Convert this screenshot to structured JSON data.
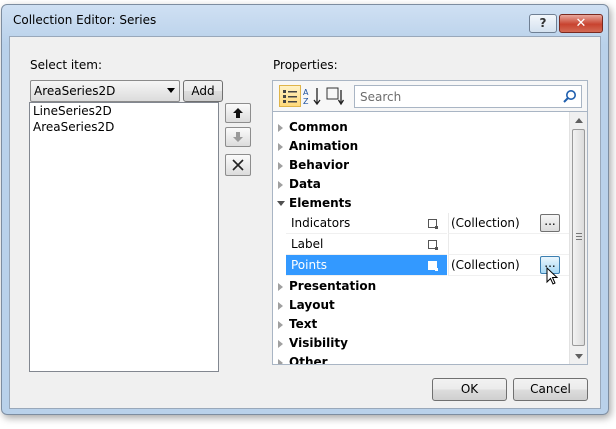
{
  "window": {
    "title": "Collection Editor: Series",
    "help_label": "?",
    "close_label": "✕"
  },
  "left": {
    "select_label": "Select item:",
    "combo_value": "AreaSeries2D",
    "add_label": "Add",
    "items": [
      "LineSeries2D",
      "AreaSeries2D"
    ]
  },
  "right": {
    "properties_label": "Properties:",
    "search_placeholder": "Search",
    "categories": {
      "common": "Common",
      "animation": "Animation",
      "behavior": "Behavior",
      "data": "Data",
      "elements": "Elements",
      "presentation": "Presentation",
      "layout": "Layout",
      "text": "Text",
      "visibility": "Visibility",
      "other": "Other"
    },
    "props": [
      {
        "name": "Indicators",
        "value": "(Collection)"
      },
      {
        "name": "Label",
        "value": ""
      },
      {
        "name": "Points",
        "value": "(Collection)"
      }
    ],
    "ellipsis": "..."
  },
  "footer": {
    "ok_label": "OK",
    "cancel_label": "Cancel"
  },
  "colors": {
    "selection": "#3399ff",
    "accent": "#ffd97a"
  },
  "icons": [
    "arrow-up-icon",
    "arrow-down-icon",
    "delete-icon",
    "categorized-icon",
    "alphabetical-icon",
    "filter-icon",
    "search-icon"
  ]
}
